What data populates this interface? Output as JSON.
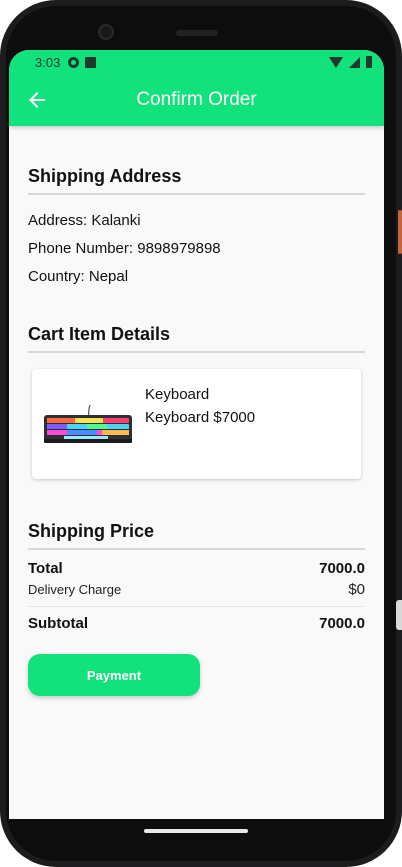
{
  "status_bar": {
    "time": "3:03"
  },
  "app_bar": {
    "title": "Confirm Order"
  },
  "shipping_address": {
    "title": "Shipping Address",
    "address": "Address: Kalanki",
    "phone": "Phone Number: 9898979898",
    "country": "Country: Nepal"
  },
  "cart": {
    "title": "Cart Item Details",
    "items": [
      {
        "name": "Keyboard",
        "meta": "Keyboard $7000",
        "image": "keyboard-image"
      }
    ]
  },
  "pricing": {
    "title": "Shipping Price",
    "total_label": "Total",
    "total_value": "7000.0",
    "delivery_label": "Delivery Charge",
    "delivery_value": "$0",
    "subtotal_label": "Subtotal",
    "subtotal_value": "7000.0"
  },
  "actions": {
    "payment_label": "Payment"
  },
  "colors": {
    "accent": "#12e27c",
    "background": "#f9f9f9"
  }
}
